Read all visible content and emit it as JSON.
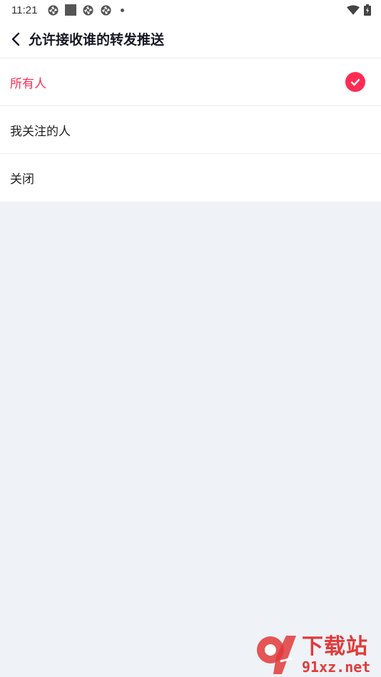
{
  "status_bar": {
    "time": "11:21",
    "icons": [
      "aperture-icon",
      "square-icon",
      "aperture-icon",
      "aperture-icon",
      "dot-icon"
    ],
    "right_icons": [
      "wifi-icon",
      "battery-icon"
    ]
  },
  "header": {
    "title": "允许接收谁的转发推送",
    "back_icon": "chevron-left-icon"
  },
  "options": [
    {
      "label": "所有人",
      "selected": true
    },
    {
      "label": "我关注的人",
      "selected": false
    },
    {
      "label": "关闭",
      "selected": false
    }
  ],
  "watermark": {
    "logo_text": "9",
    "cn": "下载站",
    "url": "91xz.net"
  },
  "colors": {
    "accent": "#fe2c55",
    "background": "#eff2f6",
    "watermark": "#e23a3a"
  }
}
